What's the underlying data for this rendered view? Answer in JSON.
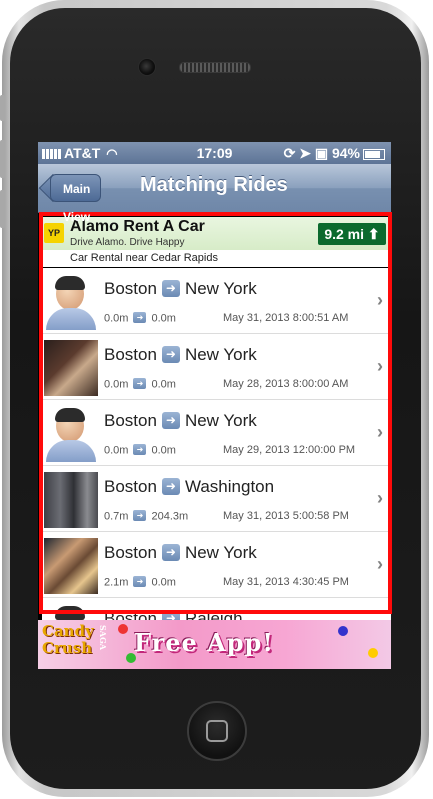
{
  "status_bar": {
    "carrier": "AT&T",
    "time": "17:09",
    "battery": "94%"
  },
  "nav": {
    "back_label": "Main View",
    "title": "Matching Rides"
  },
  "ad": {
    "logo": "YP",
    "title": "Alamo Rent A Car",
    "subtitle": "Drive Alamo. Drive Happy",
    "distance": "9.2 mi",
    "line2": "Car Rental near Cedar Rapids"
  },
  "rides": [
    {
      "from": "Boston",
      "to": "New York",
      "d1": "0.0m",
      "d2": "0.0m",
      "date": "May 31, 2013 8:00:51 AM",
      "avatar": "default"
    },
    {
      "from": "Boston",
      "to": "New York",
      "d1": "0.0m",
      "d2": "0.0m",
      "date": "May 28, 2013 8:00:00 AM",
      "avatar": "photo"
    },
    {
      "from": "Boston",
      "to": "New York",
      "d1": "0.0m",
      "d2": "0.0m",
      "date": "May 29, 2013 12:00:00 PM",
      "avatar": "default"
    },
    {
      "from": "Boston",
      "to": "Washington",
      "d1": "0.7m",
      "d2": "204.3m",
      "date": "May 31, 2013 5:00:58 PM",
      "avatar": "photo"
    },
    {
      "from": "Boston",
      "to": "New York",
      "d1": "2.1m",
      "d2": "0.0m",
      "date": "May 31, 2013 4:30:45 PM",
      "avatar": "photo"
    },
    {
      "from": "Boston",
      "to": "Raleigh",
      "d1": "",
      "d2": "",
      "date": "",
      "avatar": "default"
    }
  ],
  "banner": {
    "logo_line1": "Candy",
    "logo_line2": "Crush",
    "logo_side": "SAGA",
    "text": "Free App!"
  },
  "icons": {
    "arrow": "arrow-right-icon",
    "chevron": "chevron-right-icon"
  },
  "colors": {
    "highlight": "#ff0a0a",
    "nav": "#7890b0",
    "ad_badge": "#0b6a2e"
  }
}
